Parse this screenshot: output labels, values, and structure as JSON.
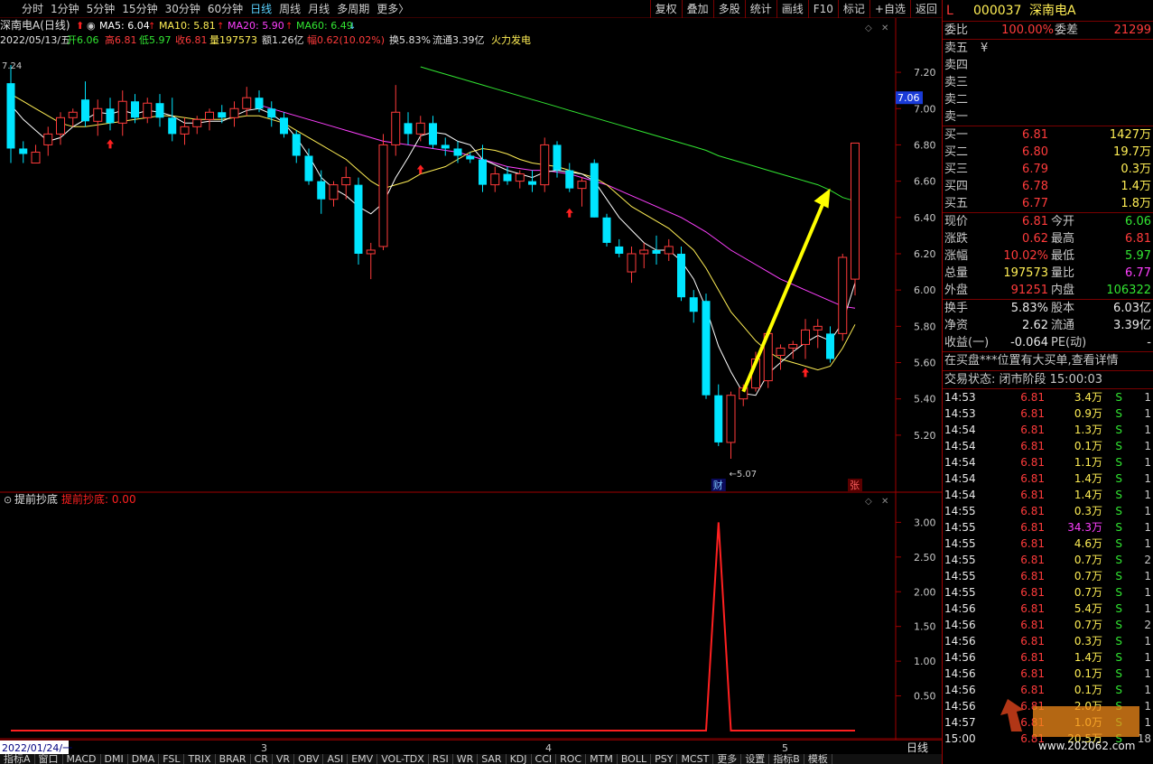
{
  "toolbar": {
    "periods": [
      "分时",
      "1分钟",
      "5分钟",
      "15分钟",
      "30分钟",
      "60分钟",
      "日线",
      "周线",
      "月线",
      "多周期",
      "更多〉"
    ],
    "active_period": "日线",
    "right_buttons": [
      "复权",
      "叠加",
      "多股",
      "统计",
      "画线",
      "F10",
      "标记",
      "+自选",
      "返回"
    ]
  },
  "chart_header": {
    "title": "深南电A(日线)",
    "ma": [
      {
        "label": "MA5: 6.04",
        "color": "#ffffff"
      },
      {
        "label": "MA10: 5.81",
        "color": "#ffee55"
      },
      {
        "label": "MA20: 5.90",
        "color": "#ff40ff"
      },
      {
        "label": "MA60: 6.49",
        "color": "#32e632"
      }
    ],
    "date": "2022/05/13/五",
    "open": "开6.06",
    "high": "高6.81",
    "low": "低5.97",
    "close": "收6.81",
    "volume": "量197573",
    "amount": "额1.26亿",
    "change": "幅0.62(10.02%)",
    "turnover": "换5.83%",
    "float_cap": "流通3.39亿",
    "concept": "火力发电",
    "high_mark": "7.24",
    "low_mark": "←5.07",
    "event_cai": "财",
    "event_zhang": "张",
    "current_price_tag": "7.06"
  },
  "y_axis_main": [
    "7.20",
    "7.00",
    "6.80",
    "6.60",
    "6.40",
    "6.20",
    "6.00",
    "5.80",
    "5.60",
    "5.40",
    "5.20"
  ],
  "indicator": {
    "name": "提前抄底",
    "value_label": "提前抄底: 0.00",
    "y_axis": [
      "3.00",
      "2.50",
      "2.00",
      "1.50",
      "1.00",
      "0.50"
    ]
  },
  "time_axis": {
    "start": "2022/01/24/一",
    "months": [
      "3",
      "4",
      "5"
    ],
    "period_label": "日线"
  },
  "indicator_tabs": [
    "指标A",
    "窗口",
    "MACD",
    "DMI",
    "DMA",
    "FSL",
    "TRIX",
    "BRAR",
    "CR",
    "VR",
    "OBV",
    "ASI",
    "EMV",
    "VOL-TDX",
    "RSI",
    "WR",
    "SAR",
    "KDJ",
    "CCI",
    "ROC",
    "MTM",
    "BOLL",
    "PSY",
    "MCST",
    "更多",
    "设置",
    "指标B",
    "模板"
  ],
  "chart_data": {
    "type": "candlestick",
    "ohlc": [
      [
        7.14,
        7.24,
        6.7,
        6.78
      ],
      [
        6.78,
        6.82,
        6.7,
        6.75
      ],
      [
        6.7,
        6.8,
        6.7,
        6.76
      ],
      [
        6.8,
        6.9,
        6.74,
        6.86
      ],
      [
        6.86,
        6.98,
        6.8,
        6.95
      ],
      [
        6.95,
        7.0,
        6.9,
        6.98
      ],
      [
        7.05,
        7.15,
        6.9,
        6.93
      ],
      [
        6.93,
        7.05,
        6.85,
        7.0
      ],
      [
        7.0,
        7.06,
        6.88,
        6.92
      ],
      [
        6.92,
        7.1,
        6.85,
        7.04
      ],
      [
        7.04,
        7.08,
        6.92,
        6.95
      ],
      [
        6.95,
        7.06,
        6.92,
        7.03
      ],
      [
        7.03,
        7.08,
        6.9,
        6.95
      ],
      [
        6.95,
        7.06,
        6.82,
        6.86
      ],
      [
        6.86,
        6.95,
        6.8,
        6.9
      ],
      [
        6.9,
        6.96,
        6.86,
        6.94
      ],
      [
        6.94,
        7.0,
        6.88,
        6.98
      ],
      [
        6.98,
        7.02,
        6.92,
        6.95
      ],
      [
        6.95,
        7.04,
        6.9,
        7.0
      ],
      [
        7.0,
        7.12,
        6.96,
        7.06
      ],
      [
        7.06,
        7.1,
        6.98,
        7.0
      ],
      [
        7.0,
        7.04,
        6.9,
        6.95
      ],
      [
        6.95,
        6.98,
        6.84,
        6.86
      ],
      [
        6.86,
        6.88,
        6.7,
        6.74
      ],
      [
        6.74,
        6.78,
        6.58,
        6.6
      ],
      [
        6.6,
        6.66,
        6.42,
        6.5
      ],
      [
        6.5,
        6.6,
        6.46,
        6.58
      ],
      [
        6.58,
        6.68,
        6.5,
        6.62
      ],
      [
        6.58,
        6.62,
        6.14,
        6.2
      ],
      [
        6.2,
        6.26,
        6.06,
        6.22
      ],
      [
        6.24,
        6.86,
        6.22,
        6.8
      ],
      [
        6.8,
        7.13,
        6.74,
        6.98
      ],
      [
        6.92,
        6.98,
        6.8,
        6.86
      ],
      [
        6.86,
        6.96,
        6.82,
        6.92
      ],
      [
        6.92,
        6.96,
        6.78,
        6.8
      ],
      [
        6.8,
        6.84,
        6.74,
        6.78
      ],
      [
        6.78,
        6.82,
        6.7,
        6.74
      ],
      [
        6.74,
        6.76,
        6.7,
        6.72
      ],
      [
        6.72,
        6.8,
        6.54,
        6.58
      ],
      [
        6.58,
        6.68,
        6.54,
        6.64
      ],
      [
        6.64,
        6.68,
        6.58,
        6.6
      ],
      [
        6.6,
        6.66,
        6.56,
        6.64
      ],
      [
        6.6,
        6.66,
        6.54,
        6.58
      ],
      [
        6.58,
        6.84,
        6.54,
        6.8
      ],
      [
        6.8,
        6.82,
        6.62,
        6.66
      ],
      [
        6.66,
        6.7,
        6.54,
        6.56
      ],
      [
        6.56,
        6.62,
        6.46,
        6.6
      ],
      [
        6.7,
        6.72,
        6.4,
        6.4
      ],
      [
        6.4,
        6.42,
        6.24,
        6.26
      ],
      [
        6.24,
        6.28,
        6.18,
        6.2
      ],
      [
        6.1,
        6.24,
        6.04,
        6.2
      ],
      [
        6.2,
        6.26,
        6.12,
        6.22
      ],
      [
        6.22,
        6.3,
        6.14,
        6.2
      ],
      [
        6.2,
        6.28,
        6.16,
        6.24
      ],
      [
        6.2,
        6.24,
        5.94,
        5.96
      ],
      [
        5.96,
        6.0,
        5.82,
        5.88
      ],
      [
        5.94,
        5.98,
        5.4,
        5.42
      ],
      [
        5.42,
        5.48,
        5.14,
        5.16
      ],
      [
        5.16,
        5.44,
        5.07,
        5.42
      ],
      [
        5.4,
        5.48,
        5.36,
        5.46
      ],
      [
        5.46,
        5.66,
        5.44,
        5.62
      ],
      [
        5.5,
        5.78,
        5.46,
        5.76
      ],
      [
        5.64,
        5.7,
        5.56,
        5.68
      ],
      [
        5.68,
        5.72,
        5.62,
        5.7
      ],
      [
        5.7,
        5.84,
        5.62,
        5.78
      ],
      [
        5.78,
        5.84,
        5.68,
        5.8
      ],
      [
        5.76,
        5.8,
        5.6,
        5.62
      ],
      [
        5.76,
        6.2,
        5.72,
        6.18
      ],
      [
        6.06,
        6.81,
        5.97,
        6.81
      ]
    ],
    "ma5": [
      7.02,
      6.94,
      6.88,
      6.82,
      6.84,
      6.9,
      6.94,
      6.98,
      6.97,
      6.99,
      6.97,
      6.99,
      6.98,
      6.96,
      6.92,
      6.92,
      6.93,
      6.93,
      6.96,
      6.99,
      7.0,
      6.97,
      6.92,
      6.84,
      6.74,
      6.62,
      6.56,
      6.52,
      6.46,
      6.42,
      6.48,
      6.62,
      6.73,
      6.85,
      6.87,
      6.86,
      6.82,
      6.8,
      6.72,
      6.69,
      6.66,
      6.64,
      6.62,
      6.65,
      6.66,
      6.65,
      6.64,
      6.6,
      6.5,
      6.4,
      6.33,
      6.26,
      6.22,
      6.22,
      6.16,
      6.06,
      5.9,
      5.69,
      5.55,
      5.43,
      5.42,
      5.54,
      5.6,
      5.66,
      5.71,
      5.75,
      5.72,
      5.82,
      6.04
    ],
    "ma10": [
      7.08,
      7.04,
      7.0,
      6.96,
      6.92,
      6.9,
      6.9,
      6.91,
      6.92,
      6.93,
      6.94,
      6.95,
      6.96,
      6.96,
      6.95,
      6.94,
      6.94,
      6.94,
      6.95,
      6.96,
      6.96,
      6.94,
      6.92,
      6.88,
      6.84,
      6.8,
      6.76,
      6.72,
      6.66,
      6.6,
      6.56,
      6.58,
      6.6,
      6.64,
      6.66,
      6.68,
      6.72,
      6.76,
      6.78,
      6.77,
      6.75,
      6.72,
      6.7,
      6.69,
      6.68,
      6.66,
      6.64,
      6.62,
      6.58,
      6.52,
      6.46,
      6.42,
      6.38,
      6.34,
      6.28,
      6.22,
      6.12,
      6.0,
      5.88,
      5.8,
      5.72,
      5.66,
      5.62,
      5.6,
      5.58,
      5.56,
      5.58,
      5.68,
      5.81
    ],
    "ma20": [
      null,
      null,
      null,
      null,
      null,
      null,
      null,
      null,
      null,
      null,
      null,
      null,
      null,
      null,
      null,
      null,
      null,
      null,
      null,
      null,
      7.02,
      7.0,
      6.98,
      6.96,
      6.94,
      6.92,
      6.9,
      6.88,
      6.86,
      6.84,
      6.82,
      6.81,
      6.8,
      6.79,
      6.78,
      6.77,
      6.76,
      6.74,
      6.72,
      6.7,
      6.68,
      6.67,
      6.66,
      6.66,
      6.65,
      6.64,
      6.62,
      6.6,
      6.58,
      6.55,
      6.52,
      6.49,
      6.46,
      6.43,
      6.4,
      6.36,
      6.32,
      6.27,
      6.22,
      6.18,
      6.14,
      6.1,
      6.06,
      6.03,
      6.0,
      5.97,
      5.94,
      5.91,
      5.9
    ],
    "ma60": [
      null,
      null,
      null,
      null,
      null,
      null,
      null,
      null,
      null,
      null,
      null,
      null,
      null,
      null,
      null,
      null,
      null,
      null,
      null,
      null,
      null,
      null,
      null,
      null,
      null,
      null,
      null,
      null,
      null,
      null,
      null,
      null,
      null,
      7.23,
      7.21,
      7.19,
      7.17,
      7.15,
      7.13,
      7.11,
      7.09,
      7.07,
      7.05,
      7.03,
      7.01,
      6.99,
      6.97,
      6.95,
      6.93,
      6.91,
      6.89,
      6.87,
      6.85,
      6.83,
      6.81,
      6.79,
      6.77,
      6.74,
      6.72,
      6.7,
      6.68,
      6.66,
      6.64,
      6.62,
      6.6,
      6.58,
      6.55,
      6.51,
      6.49
    ],
    "indicator_values": [
      0,
      0,
      0,
      0,
      0,
      0,
      0,
      0,
      0,
      0,
      0,
      0,
      0,
      0,
      0,
      0,
      0,
      0,
      0,
      0,
      0,
      0,
      0,
      0,
      0,
      0,
      0,
      0,
      0,
      0,
      0,
      0,
      0,
      0,
      0,
      0,
      0,
      0,
      0,
      0,
      0,
      0,
      0,
      0,
      0,
      0,
      0,
      0,
      0,
      0,
      0,
      0,
      0,
      0,
      0,
      0,
      0,
      3.0,
      0,
      0,
      0,
      0,
      0,
      0,
      0,
      0,
      0,
      0,
      0
    ],
    "ylim_main": [
      5.0,
      7.3
    ],
    "ylim_indicator": [
      0,
      3.2
    ],
    "colors": {
      "up": "#ff3b3b",
      "down": "#00e5ff",
      "ma5": "#ffffff",
      "ma10": "#ffee55",
      "ma20": "#ff40ff",
      "ma60": "#32e632",
      "indicator": "#ff2020",
      "arrow": "#ffff00"
    }
  },
  "panel": {
    "market_flag": "L",
    "code": "000037",
    "name": "深南电A",
    "weibi_label": "委比",
    "weibi": "100.00%",
    "weicha_label": "委差",
    "weicha": "21299",
    "sell": [
      {
        "label": "卖五",
        "price": "¥",
        "vol": ""
      },
      {
        "label": "卖四",
        "price": "",
        "vol": ""
      },
      {
        "label": "卖三",
        "price": "",
        "vol": ""
      },
      {
        "label": "卖二",
        "price": "",
        "vol": ""
      },
      {
        "label": "卖一",
        "price": "",
        "vol": ""
      }
    ],
    "buy": [
      {
        "label": "买一",
        "price": "6.81",
        "vol": "1427万"
      },
      {
        "label": "买二",
        "price": "6.80",
        "vol": "19.7万"
      },
      {
        "label": "买三",
        "price": "6.79",
        "vol": "0.3万"
      },
      {
        "label": "买四",
        "price": "6.78",
        "vol": "1.4万"
      },
      {
        "label": "买五",
        "price": "6.77",
        "vol": "1.8万"
      }
    ],
    "stats": [
      {
        "l1": "现价",
        "v1": "6.81",
        "c1": "red",
        "l2": "今开",
        "v2": "6.06",
        "c2": "green"
      },
      {
        "l1": "涨跌",
        "v1": "0.62",
        "c1": "red",
        "l2": "最高",
        "v2": "6.81",
        "c2": "red"
      },
      {
        "l1": "涨幅",
        "v1": "10.02%",
        "c1": "red",
        "l2": "最低",
        "v2": "5.97",
        "c2": "green"
      },
      {
        "l1": "总量",
        "v1": "197573",
        "c1": "yellow",
        "l2": "量比",
        "v2": "6.77",
        "c2": "magenta"
      },
      {
        "l1": "外盘",
        "v1": "91251",
        "c1": "red",
        "l2": "内盘",
        "v2": "106322",
        "c2": "green"
      }
    ],
    "stats2": [
      {
        "l1": "换手",
        "v1": "5.83%",
        "l2": "股本",
        "v2": "6.03亿"
      },
      {
        "l1": "净资",
        "v1": "2.62",
        "l2": "流通",
        "v2": "3.39亿"
      },
      {
        "l1": "收益(一)",
        "v1": "-0.064",
        "l2": "PE(动)",
        "v2": "-"
      }
    ],
    "notice": "在买盘***位置有大买单,查看详情",
    "trade_status": "交易状态: 闭市阶段 15:00:03",
    "ticks": [
      {
        "t": "14:53",
        "p": "6.81",
        "v": "3.4万",
        "s": "S",
        "n": "1"
      },
      {
        "t": "14:53",
        "p": "6.81",
        "v": "0.9万",
        "s": "S",
        "n": "1"
      },
      {
        "t": "14:54",
        "p": "6.81",
        "v": "1.3万",
        "s": "S",
        "n": "1"
      },
      {
        "t": "14:54",
        "p": "6.81",
        "v": "0.1万",
        "s": "S",
        "n": "1"
      },
      {
        "t": "14:54",
        "p": "6.81",
        "v": "1.1万",
        "s": "S",
        "n": "1"
      },
      {
        "t": "14:54",
        "p": "6.81",
        "v": "1.4万",
        "s": "S",
        "n": "1"
      },
      {
        "t": "14:54",
        "p": "6.81",
        "v": "1.4万",
        "s": "S",
        "n": "1"
      },
      {
        "t": "14:55",
        "p": "6.81",
        "v": "0.3万",
        "s": "S",
        "n": "1"
      },
      {
        "t": "14:55",
        "p": "6.81",
        "v": "34.3万",
        "s": "S",
        "n": "1"
      },
      {
        "t": "14:55",
        "p": "6.81",
        "v": "4.6万",
        "s": "S",
        "n": "1"
      },
      {
        "t": "14:55",
        "p": "6.81",
        "v": "0.7万",
        "s": "S",
        "n": "2"
      },
      {
        "t": "14:55",
        "p": "6.81",
        "v": "0.7万",
        "s": "S",
        "n": "1"
      },
      {
        "t": "14:55",
        "p": "6.81",
        "v": "0.7万",
        "s": "S",
        "n": "1"
      },
      {
        "t": "14:56",
        "p": "6.81",
        "v": "5.4万",
        "s": "S",
        "n": "1"
      },
      {
        "t": "14:56",
        "p": "6.81",
        "v": "0.7万",
        "s": "S",
        "n": "2"
      },
      {
        "t": "14:56",
        "p": "6.81",
        "v": "0.3万",
        "s": "S",
        "n": "1"
      },
      {
        "t": "14:56",
        "p": "6.81",
        "v": "1.4万",
        "s": "S",
        "n": "1"
      },
      {
        "t": "14:56",
        "p": "6.81",
        "v": "0.1万",
        "s": "S",
        "n": "1"
      },
      {
        "t": "14:56",
        "p": "6.81",
        "v": "0.1万",
        "s": "S",
        "n": "1"
      },
      {
        "t": "14:56",
        "p": "6.81",
        "v": "2.0万",
        "s": "S",
        "n": "1"
      },
      {
        "t": "14:57",
        "p": "6.81",
        "v": "1.0万",
        "s": "S",
        "n": "1"
      },
      {
        "t": "15:00",
        "p": "6.81",
        "v": "20.5万",
        "s": "S",
        "n": "18"
      }
    ],
    "watermark": "www.202062.com"
  }
}
